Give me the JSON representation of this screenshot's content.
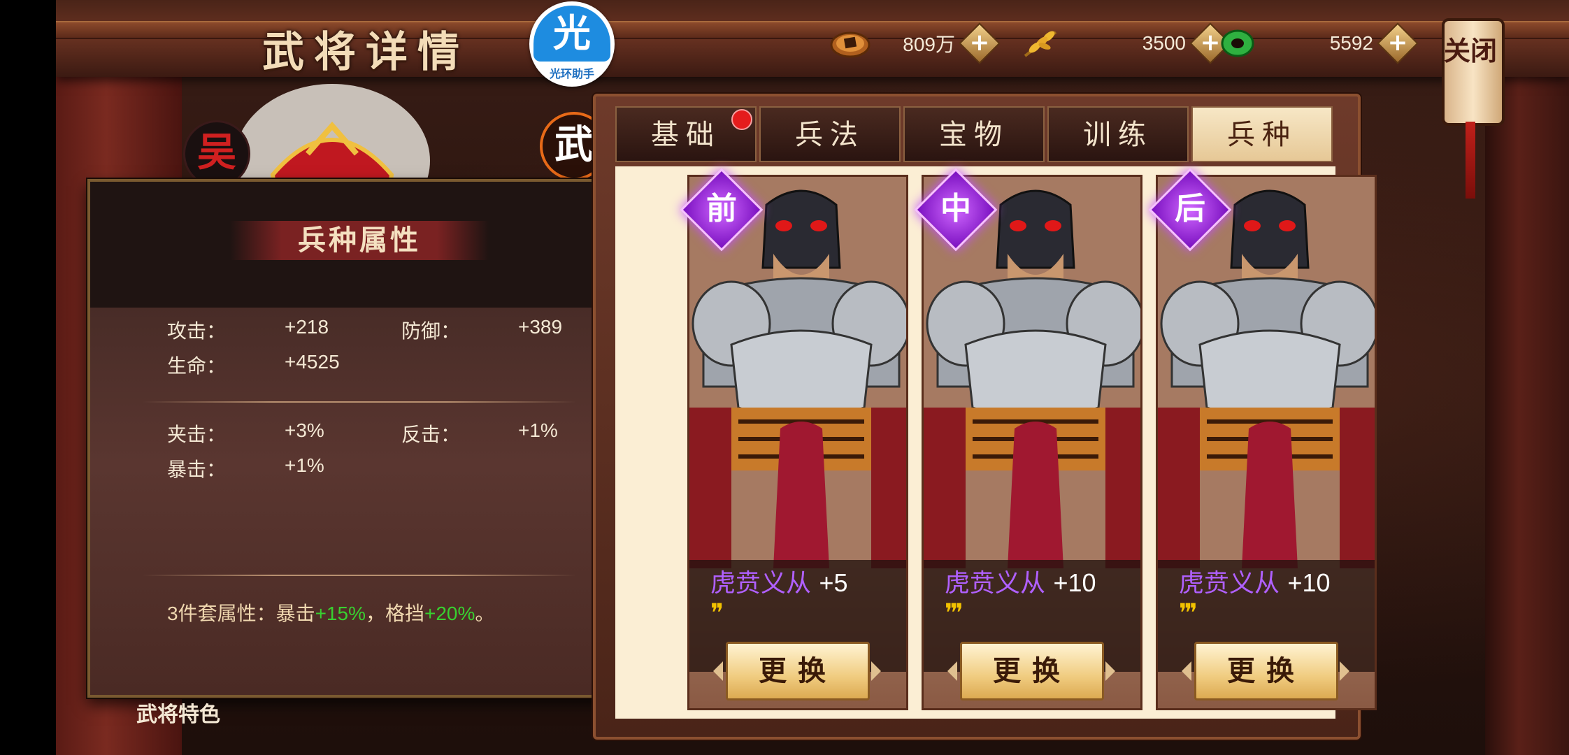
{
  "header": {
    "title": "武将详情",
    "close_label": "关闭"
  },
  "watermark": {
    "glyph": "光",
    "label": "光环助手"
  },
  "resources": [
    {
      "name": "copper",
      "value": "809万",
      "icon": "coin-icon",
      "color": "#c0702a"
    },
    {
      "name": "grain",
      "value": "3500",
      "icon": "wheat-icon",
      "color": "#e0a830"
    },
    {
      "name": "jade",
      "value": "5592",
      "icon": "jade-ring-icon",
      "color": "#2fb040"
    }
  ],
  "hero": {
    "faction": "吴",
    "type": "武",
    "trait_label": "武将特色"
  },
  "stats_panel": {
    "title": "兵种属性",
    "group1": [
      {
        "label": "攻击：",
        "value": "+218"
      },
      {
        "label": "防御：",
        "value": "+389"
      },
      {
        "label": "生命：",
        "value": "+4525"
      }
    ],
    "group2": [
      {
        "label": "夹击：",
        "value": "+3%"
      },
      {
        "label": "反击：",
        "value": "+1%"
      },
      {
        "label": "暴击：",
        "value": "+1%"
      }
    ],
    "set_bonus": {
      "prefix": "3件套属性：暴击",
      "v1": "+15%",
      "mid": "，格挡",
      "v2": "+20%",
      "suffix": "。"
    }
  },
  "tabs": [
    {
      "label": "基础",
      "active": false,
      "has_dot": true
    },
    {
      "label": "兵法",
      "active": false,
      "has_dot": false
    },
    {
      "label": "宝物",
      "active": false,
      "has_dot": false
    },
    {
      "label": "训练",
      "active": false,
      "has_dot": false
    },
    {
      "label": "兵种",
      "active": true,
      "has_dot": false
    }
  ],
  "troops": [
    {
      "position": "前",
      "name": "虎贲义从",
      "level": "+5",
      "pips": 2,
      "button": "更换"
    },
    {
      "position": "中",
      "name": "虎贲义从",
      "level": "+10",
      "pips": 3,
      "button": "更换"
    },
    {
      "position": "后",
      "name": "虎贲义从",
      "level": "+10",
      "pips": 3,
      "button": "更换"
    }
  ]
}
